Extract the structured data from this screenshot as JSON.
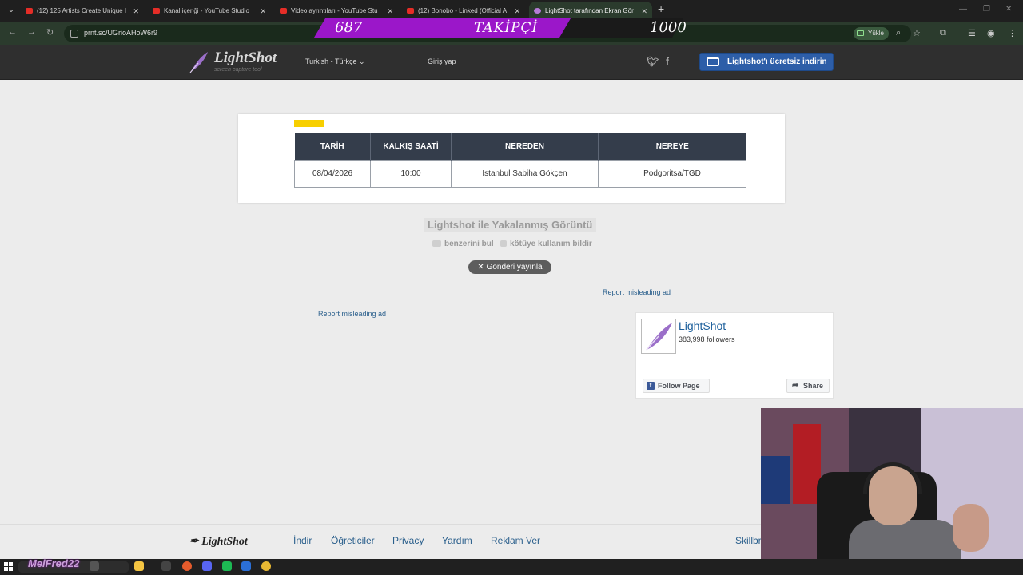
{
  "browser": {
    "tabs": [
      {
        "title": "(12) 125 Artists Create Unique I",
        "favicon": "youtube-icon",
        "active": false
      },
      {
        "title": "Kanal içeriği - YouTube Studio",
        "favicon": "youtube-icon",
        "active": false
      },
      {
        "title": "Video ayrıntıları - YouTube Stu",
        "favicon": "youtube-icon",
        "active": false
      },
      {
        "title": "(12) Bonobo - Linked (Official A",
        "favicon": "youtube-icon",
        "active": false
      },
      {
        "title": "LightShot tarafından Ekran Gör",
        "favicon": "lightshot-icon",
        "active": true
      }
    ],
    "url": "prnt.sc/UGrioAHoW6r9",
    "upload_label": "Yükle"
  },
  "overlay": {
    "current": "687",
    "label": "TAKİPÇİ",
    "goal": "1000",
    "progress_fraction": 0.687,
    "fill_color": "#9b17c9"
  },
  "header": {
    "logo": "LightShot",
    "logo_sub": "screen capture tool",
    "language": "Turkish - Türkçe",
    "login": "Giriş yap",
    "download_button": "Lightshot'ı ücretsiz indirin"
  },
  "screenshot": {
    "table": {
      "headers": [
        "TARİH",
        "KALKIŞ SAATİ",
        "NEREDEN",
        "NEREYE"
      ],
      "rows": [
        [
          "08/04/2026",
          "10:00",
          "İstanbul Sabiha Gökçen",
          "Podgoritsa/TGD"
        ]
      ]
    }
  },
  "meta": {
    "caption": "Lightshot ile Yakalanmış Görüntü",
    "find_similar": "benzerini bul",
    "report_abuse": "kötüye kullanım bildir",
    "tweet": "Gönderi yayınla",
    "report_ad_1": "Report misleading ad",
    "report_ad_2": "Report misleading ad"
  },
  "facebook": {
    "page_name": "LightShot",
    "followers": "383,998 followers",
    "follow": "Follow Page",
    "share": "Share"
  },
  "footer": {
    "logo": "LightShot",
    "links": [
      "İndir",
      "Öğreticiler",
      "Privacy",
      "Yardım",
      "Reklam Ver",
      "Skillbr"
    ]
  },
  "taskbar": {
    "watermark": "MelFred22"
  }
}
